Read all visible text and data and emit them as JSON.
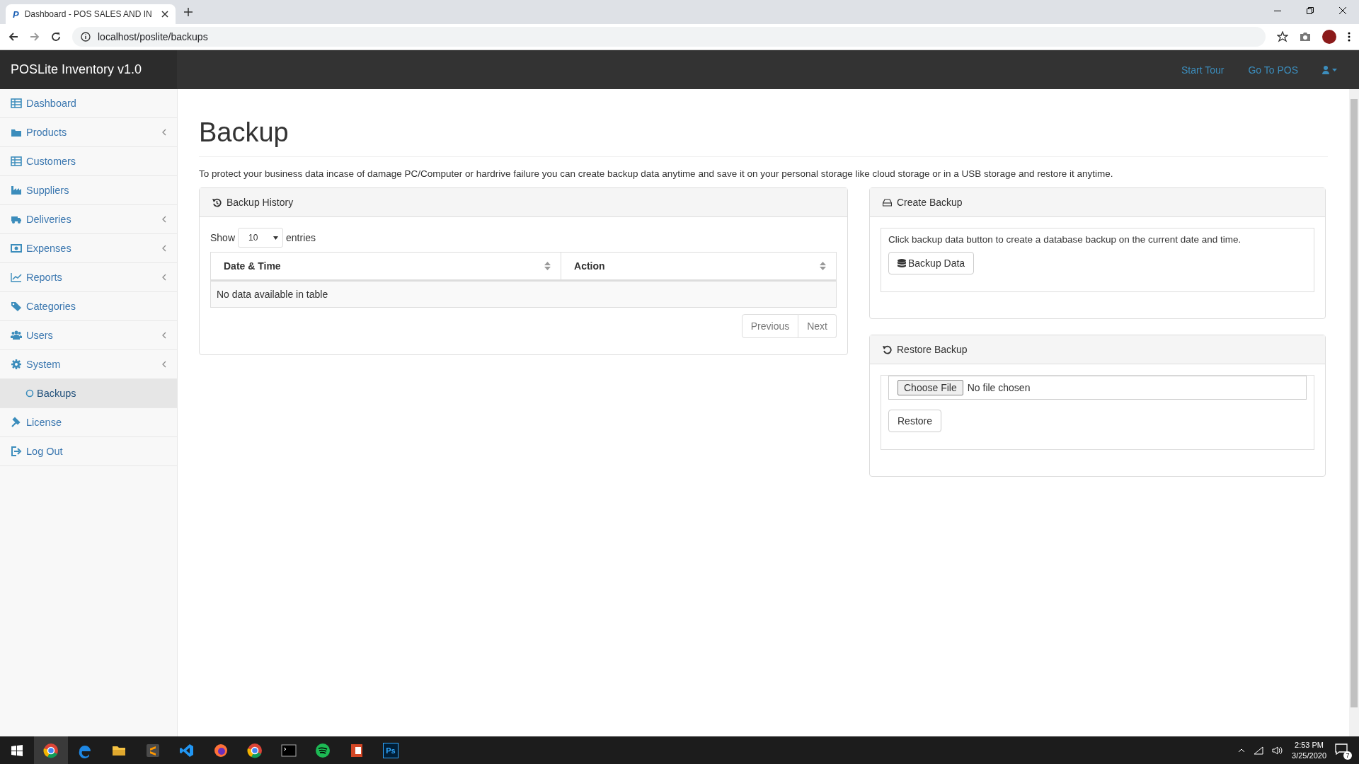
{
  "browser": {
    "favicon": "P",
    "tab_title": "Dashboard - POS SALES AND IN",
    "url": "localhost/poslite/backups"
  },
  "navbar": {
    "brand": "POSLite Inventory v1.0",
    "links": [
      "Start Tour",
      "Go To POS"
    ]
  },
  "sidebar": {
    "items": [
      {
        "label": "Dashboard",
        "has_submenu": false,
        "selected": false
      },
      {
        "label": "Products",
        "has_submenu": true,
        "selected": false
      },
      {
        "label": "Customers",
        "has_submenu": false,
        "selected": false
      },
      {
        "label": "Suppliers",
        "has_submenu": false,
        "selected": false
      },
      {
        "label": "Deliveries",
        "has_submenu": true,
        "selected": false
      },
      {
        "label": "Expenses",
        "has_submenu": true,
        "selected": false
      },
      {
        "label": "Reports",
        "has_submenu": true,
        "selected": false
      },
      {
        "label": "Categories",
        "has_submenu": false,
        "selected": false
      },
      {
        "label": "Users",
        "has_submenu": true,
        "selected": false
      },
      {
        "label": "System",
        "has_submenu": true,
        "selected": false,
        "children": [
          {
            "label": "Backups",
            "selected": true
          }
        ]
      },
      {
        "label": "License",
        "has_submenu": false,
        "selected": false
      },
      {
        "label": "Log Out",
        "has_submenu": false,
        "selected": false
      }
    ]
  },
  "page": {
    "title": "Backup",
    "description": "To protect your business data incase of damage PC/Computer or hardrive failure you can create backup data anytime and save it on your personal storage like cloud storage or in a USB storage and restore it anytime."
  },
  "history": {
    "title": "Backup History",
    "show_label": "Show",
    "page_size": "10",
    "entries_label": "entries",
    "columns": [
      "Date & Time",
      "Action"
    ],
    "empty_text": "No data available in table",
    "pager": [
      {
        "label": "Previous",
        "disabled": true
      },
      {
        "label": "Next",
        "disabled": true
      }
    ]
  },
  "create": {
    "title": "Create Backup",
    "text": "Click backup data button to create a database backup on the current date and time.",
    "button": "Backup Data"
  },
  "restore": {
    "title": "Restore Backup",
    "file_button": "Choose File",
    "file_status": "No file chosen",
    "button": "Restore"
  },
  "taskbar": {
    "time": "2:53 PM",
    "date": "3/25/2020",
    "notifications": "7",
    "ps_label": "Ps"
  }
}
